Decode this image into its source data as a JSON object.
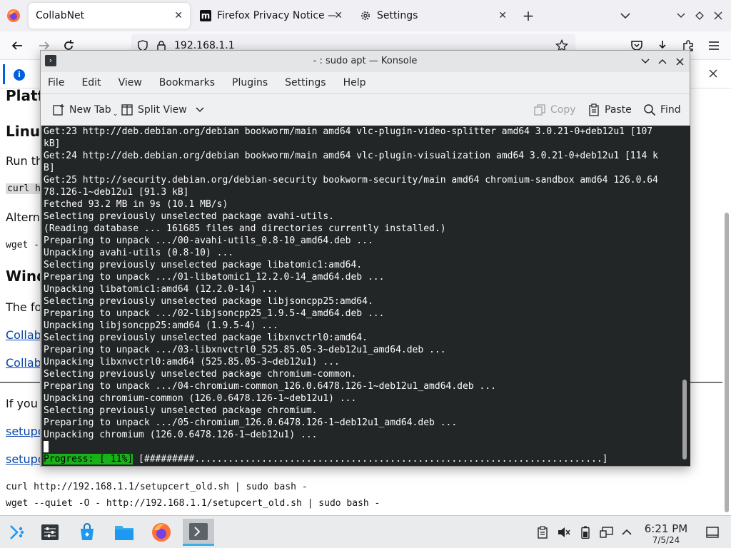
{
  "firefox": {
    "tabs": [
      {
        "title": "CollabNet",
        "favicon": "firefox-logo-icon",
        "active": true
      },
      {
        "title": "Firefox Privacy Notice — M",
        "favicon": "mozilla-m-icon",
        "active": false
      },
      {
        "title": "Settings",
        "favicon": "gear-icon",
        "active": false
      }
    ],
    "tab_close_glyph": "✕",
    "new_tab_glyph": "+",
    "url": "192.168.1.1"
  },
  "page": {
    "fragments": [
      {
        "name": "page-heading-platform",
        "text": "Platf",
        "kind": "heading"
      },
      {
        "name": "page-heading-linux",
        "text": "Linux",
        "kind": "heading"
      },
      {
        "name": "page-text-run",
        "text": "Run th",
        "kind": "text"
      },
      {
        "name": "page-code-curl",
        "text": "curl ht",
        "kind": "code"
      },
      {
        "name": "page-text-alternative",
        "text": "Altern",
        "kind": "text"
      },
      {
        "name": "page-code-wget",
        "text": "wget --",
        "kind": "code"
      },
      {
        "name": "page-heading-windows",
        "text": "Wind",
        "kind": "heading"
      },
      {
        "name": "page-text-following",
        "text": "The fo",
        "kind": "text"
      },
      {
        "name": "page-link-collab-1",
        "text": "Collab",
        "kind": "link"
      },
      {
        "name": "page-link-collab-2",
        "text": "Collab",
        "kind": "link"
      },
      {
        "name": "page-text-if-you",
        "text": "If you",
        "kind": "text"
      },
      {
        "name": "page-link-setup-1",
        "text": "setupc",
        "kind": "link"
      },
      {
        "name": "page-link-setup-2",
        "text": "setupc",
        "kind": "link"
      },
      {
        "name": "page-code-curl-old",
        "text": "curl http://192.168.1.1/setupcert_old.sh | sudo bash -",
        "kind": "code"
      },
      {
        "name": "page-code-wget-old",
        "text": "wget --quiet -O - http://192.168.1.1/setupcert_old.sh | sudo bash -",
        "kind": "code"
      }
    ]
  },
  "konsole": {
    "title": "- : sudo apt — Konsole",
    "menu": [
      "File",
      "Edit",
      "View",
      "Bookmarks",
      "Plugins",
      "Settings",
      "Help"
    ],
    "toolbar": {
      "new_tab": "New Tab",
      "split_view": "Split View",
      "copy": "Copy",
      "paste": "Paste",
      "find": "Find"
    },
    "terminal_lines": [
      "Get:23 http://deb.debian.org/debian bookworm/main amd64 vlc-plugin-video-splitter amd64 3.0.21-0+deb12u1 [107",
      "kB]",
      "Get:24 http://deb.debian.org/debian bookworm/main amd64 vlc-plugin-visualization amd64 3.0.21-0+deb12u1 [114 k",
      "B]",
      "Get:25 http://security.debian.org/debian-security bookworm-security/main amd64 chromium-sandbox amd64 126.0.64",
      "78.126-1~deb12u1 [91.3 kB]",
      "Fetched 93.2 MB in 9s (10.1 MB/s)",
      "Selecting previously unselected package avahi-utils.",
      "(Reading database ... 161685 files and directories currently installed.)",
      "Preparing to unpack .../00-avahi-utils_0.8-10_amd64.deb ...",
      "Unpacking avahi-utils (0.8-10) ...",
      "Selecting previously unselected package libatomic1:amd64.",
      "Preparing to unpack .../01-libatomic1_12.2.0-14_amd64.deb ...",
      "Unpacking libatomic1:amd64 (12.2.0-14) ...",
      "Selecting previously unselected package libjsoncpp25:amd64.",
      "Preparing to unpack .../02-libjsoncpp25_1.9.5-4_amd64.deb ...",
      "Unpacking libjsoncpp25:amd64 (1.9.5-4) ...",
      "Selecting previously unselected package libxnvctrl0:amd64.",
      "Preparing to unpack .../03-libxnvctrl0_525.85.05-3~deb12u1_amd64.deb ...",
      "Unpacking libxnvctrl0:amd64 (525.85.05-3~deb12u1) ...",
      "Selecting previously unselected package chromium-common.",
      "Preparing to unpack .../04-chromium-common_126.0.6478.126-1~deb12u1_amd64.deb ...",
      "Unpacking chromium-common (126.0.6478.126-1~deb12u1) ...",
      "Selecting previously unselected package chromium.",
      "Preparing to unpack .../05-chromium_126.0.6478.126-1~deb12u1_amd64.deb ...",
      "Unpacking chromium (126.0.6478.126-1~deb12u1) ..."
    ],
    "progress": {
      "label": "Progress: [ 11%]",
      "bar": " [#########.........................................................................]",
      "percent": 11
    }
  },
  "taskbar": {
    "apps": [
      "application-launcher-icon",
      "system-settings-icon",
      "discover-store-icon",
      "dolphin-files-icon",
      "firefox-icon",
      "konsole-icon"
    ],
    "tray": [
      "clipboard-icon",
      "volume-muted-icon",
      "battery-icon",
      "network-icon",
      "tray-expand-icon"
    ],
    "time": "6:21 PM",
    "date": "7/5/24"
  },
  "colors": {
    "terminal_bg": "#232627",
    "terminal_fg": "#fcfcfc",
    "progress_green": "#18b218",
    "accent": "#3daee9"
  }
}
